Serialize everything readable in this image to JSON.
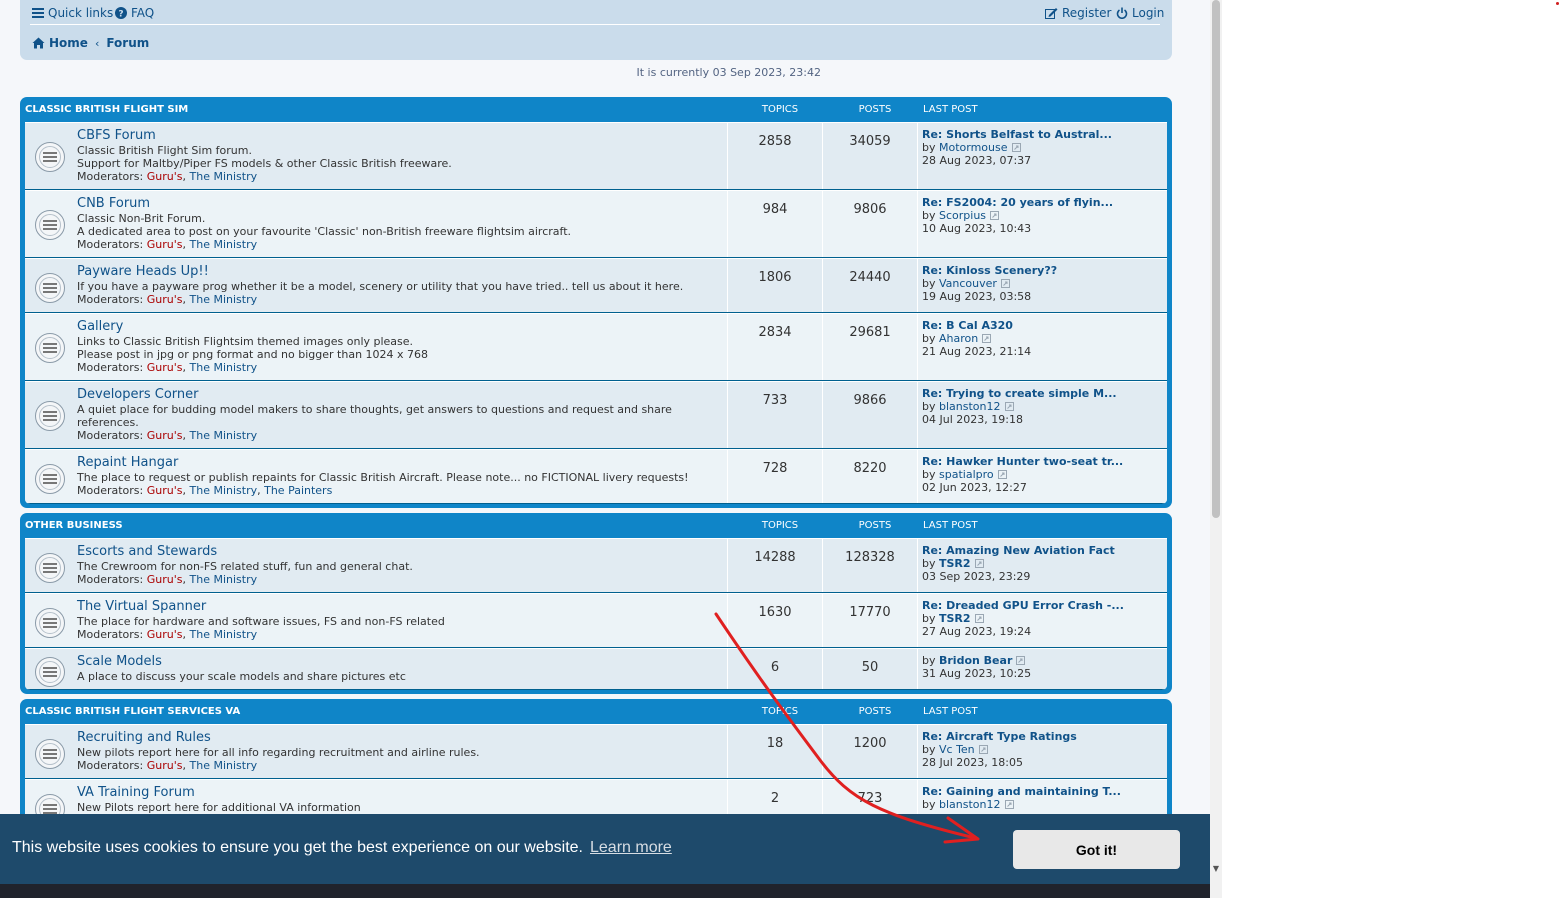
{
  "nav": {
    "quick_links": "Quick links",
    "faq": "FAQ",
    "register": "Register",
    "login": "Login",
    "home": "Home",
    "forum": "Forum"
  },
  "time_info": "It is currently 03 Sep 2023, 23:42",
  "headers": {
    "topics": "TOPICS",
    "posts": "POSTS",
    "last_post": "LAST POST"
  },
  "mods_label": "Moderators:",
  "by_label": "by",
  "categories": [
    {
      "title": "CLASSIC BRITISH FLIGHT SIM",
      "forums": [
        {
          "name": "CBFS Forum",
          "desc": [
            "Classic British Flight Sim forum.",
            "Support for Maltby/Piper FS models & other Classic British freeware."
          ],
          "mods": [
            "Guru's",
            "The Ministry"
          ],
          "topics": "2858",
          "posts": "34059",
          "last_title": "Re: Shorts Belfast to Austral...",
          "last_user": "Motormouse",
          "last_date": "28 Aug 2023, 07:37"
        },
        {
          "name": "CNB Forum",
          "desc": [
            "Classic Non-Brit Forum.",
            "A dedicated area to post on your favourite 'Classic' non-British freeware flightsim aircraft."
          ],
          "mods": [
            "Guru's",
            "The Ministry"
          ],
          "topics": "984",
          "posts": "9806",
          "last_title": "Re: FS2004: 20 years of flyin...",
          "last_user": "Scorpius",
          "last_date": "10 Aug 2023, 10:43"
        },
        {
          "name": "Payware Heads Up!!",
          "desc": [
            "If you have a payware prog whether it be a model, scenery or utility that you have tried.. tell us about it here."
          ],
          "mods": [
            "Guru's",
            "The Ministry"
          ],
          "topics": "1806",
          "posts": "24440",
          "last_title": "Re: Kinloss Scenery??",
          "last_user": "Vancouver",
          "last_date": "19 Aug 2023, 03:58"
        },
        {
          "name": "Gallery",
          "desc": [
            "Links to Classic British Flightsim themed images only please.",
            "Please post in jpg or png format and no bigger than 1024 x 768"
          ],
          "mods": [
            "Guru's",
            "The Ministry"
          ],
          "topics": "2834",
          "posts": "29681",
          "last_title": "Re: B Cal A320",
          "last_user": "Aharon",
          "last_date": "21 Aug 2023, 21:14"
        },
        {
          "name": "Developers Corner",
          "desc": [
            "A quiet place for budding model makers to share thoughts, get answers to questions and request and share",
            "references."
          ],
          "mods": [
            "Guru's",
            "The Ministry"
          ],
          "topics": "733",
          "posts": "9866",
          "last_title": "Re: Trying to create simple M...",
          "last_user": "blanston12",
          "last_date": "04 Jul 2023, 19:18"
        },
        {
          "name": "Repaint Hangar",
          "desc": [
            "The place to request or publish repaints for Classic British Aircraft. Please note... no FICTIONAL livery requests!"
          ],
          "mods": [
            "Guru's",
            "The Ministry",
            "The Painters"
          ],
          "topics": "728",
          "posts": "8220",
          "last_title": "Re: Hawker Hunter two-seat tr...",
          "last_user": "spatialpro",
          "last_date": "02 Jun 2023, 12:27"
        }
      ]
    },
    {
      "title": "OTHER BUSINESS",
      "forums": [
        {
          "name": "Escorts and Stewards",
          "desc": [
            "The Crewroom for non-FS related stuff, fun and general chat."
          ],
          "mods": [
            "Guru's",
            "The Ministry"
          ],
          "topics": "14288",
          "posts": "128328",
          "last_title": "Re: Amazing New Aviation Fact",
          "last_user": "TSR2",
          "last_date": "03 Sep 2023, 23:29"
        },
        {
          "name": "The Virtual Spanner",
          "desc": [
            "The place for hardware and software issues, FS and non-FS related"
          ],
          "mods": [
            "Guru's",
            "The Ministry"
          ],
          "topics": "1630",
          "posts": "17770",
          "last_title": "Re: Dreaded GPU Error Crash -...",
          "last_user": "TSR2",
          "last_date": "27 Aug 2023, 19:24"
        },
        {
          "name": "Scale Models",
          "desc": [
            "A place to discuss your scale models and share pictures etc"
          ],
          "mods": [],
          "topics": "6",
          "posts": "50",
          "last_title": "",
          "last_user": "Bridon Bear",
          "last_date": "31 Aug 2023, 10:25"
        }
      ]
    },
    {
      "title": "CLASSIC BRITISH FLIGHT SERVICES VA",
      "forums": [
        {
          "name": "Recruiting and Rules",
          "desc": [
            "New pilots report here for all info regarding recruitment and airline rules."
          ],
          "mods": [
            "Guru's",
            "The Ministry"
          ],
          "topics": "18",
          "posts": "1200",
          "last_title": "Re: Aircraft Type Ratings",
          "last_user": "Vc Ten",
          "last_date": "28 Jul 2023, 18:05"
        },
        {
          "name": "VA Training Forum",
          "desc": [
            "New Pilots report here for additional VA information"
          ],
          "mods": [],
          "topics": "2",
          "posts": "723",
          "last_title": "Re: Gaining and maintaining T...",
          "last_user": "blanston12",
          "last_date": ""
        }
      ]
    }
  ],
  "cookie": {
    "message": "This website uses cookies to ensure you get the best experience on our website.",
    "learn_more": "Learn more",
    "button": "Got it!"
  },
  "colors": {
    "header_blue": "#0f85c8",
    "row_bg": "#e1ebf2",
    "link": "#105289",
    "moderator_group": "#aa0000",
    "cookie_banner": "#1e4a6b",
    "annotation_arrow": "#e02020"
  }
}
